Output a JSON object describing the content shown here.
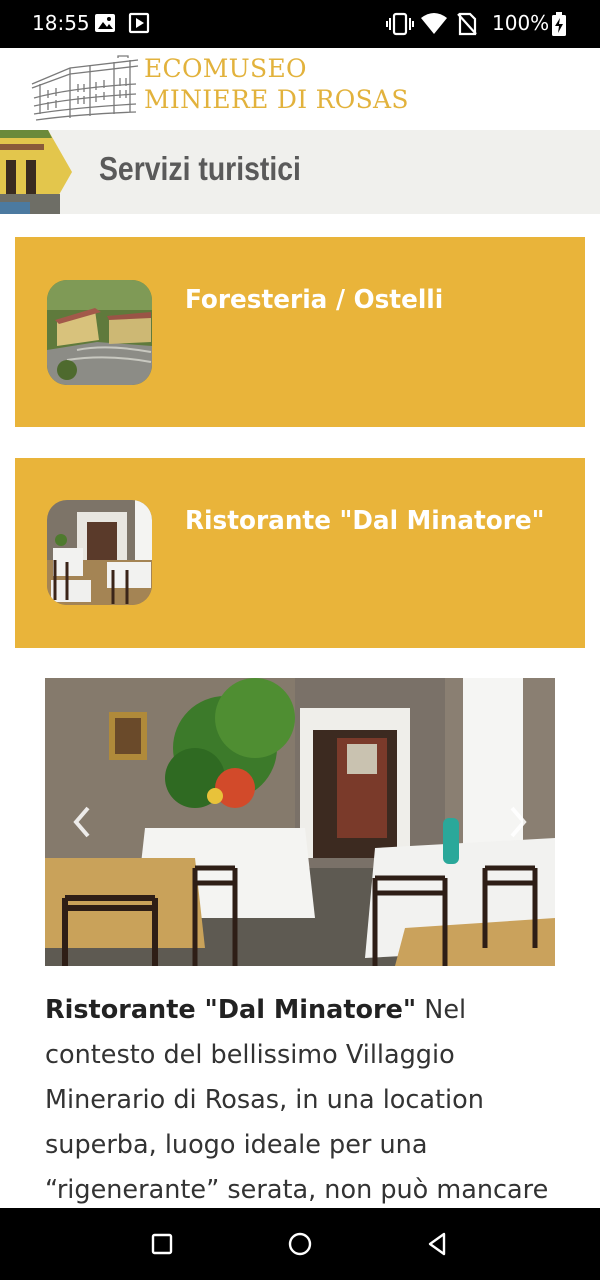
{
  "status_bar": {
    "time": "18:55",
    "battery": "100%",
    "icons": [
      "image-icon",
      "media-icon",
      "vibrate-icon",
      "wifi-icon",
      "no-sim-icon",
      "battery-charging-icon"
    ]
  },
  "header": {
    "logo_line1": "ECOMUSEO",
    "logo_line2": "MINIERE DI ROSAS",
    "logo_color": "#e2b23c"
  },
  "section": {
    "title": "Servizi turistici"
  },
  "services": [
    {
      "title": "Foresteria / Ostelli"
    },
    {
      "title": "Ristorante \"Dal Minatore\""
    }
  ],
  "card_color": "#e9b43a",
  "carousel": {
    "prev_icon": "chevron-left-icon",
    "next_icon": "chevron-right-icon"
  },
  "description": {
    "bold": "Ristorante \"Dal Minatore\"",
    "text": " Nel contesto del bellissimo Villaggio Minerario di Rosas, in una location superba, luogo ideale per una “rigenerante” serata, non può mancare"
  },
  "nav": {
    "buttons": [
      "recents-button",
      "home-button",
      "back-button"
    ]
  }
}
